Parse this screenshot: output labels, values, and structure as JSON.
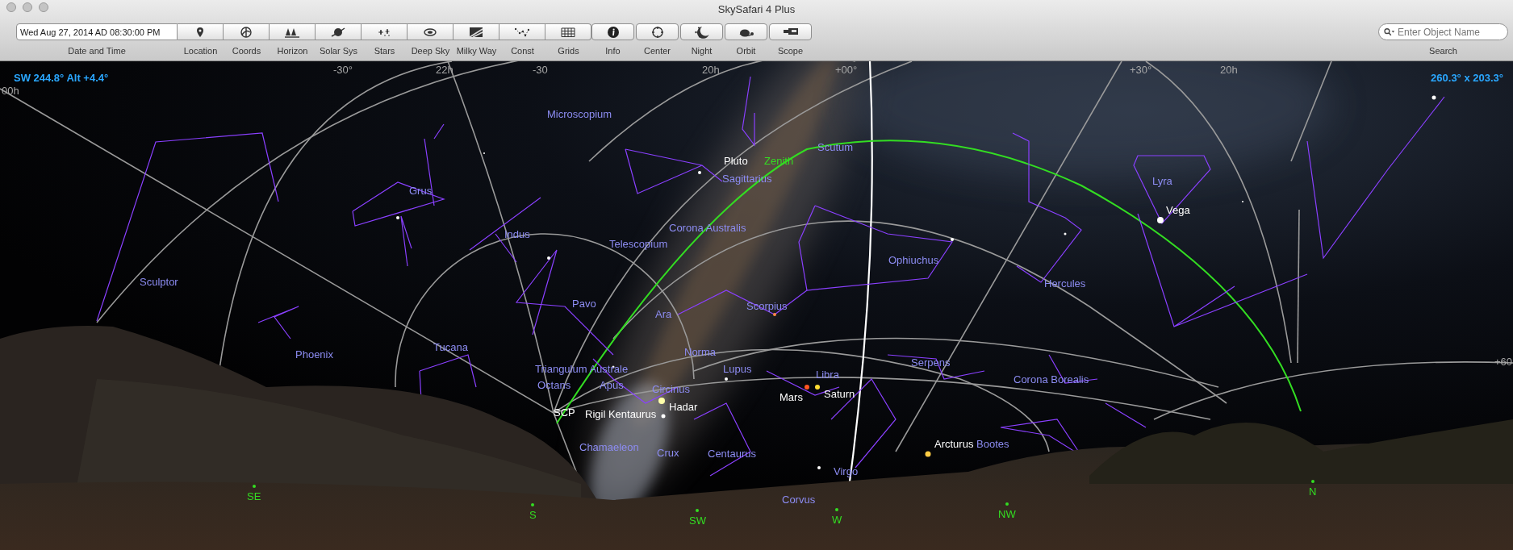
{
  "window": {
    "title": "SkySafari 4 Plus"
  },
  "toolbar": {
    "date_time": {
      "value": "Wed Aug 27, 2014 AD 08:30:00 PM",
      "label": "Date and Time"
    },
    "view_buttons": [
      {
        "label": "Location"
      },
      {
        "label": "Coords"
      },
      {
        "label": "Horizon"
      },
      {
        "label": "Solar Sys"
      },
      {
        "label": "Stars"
      },
      {
        "label": "Deep Sky"
      },
      {
        "label": "Milky Way"
      },
      {
        "label": "Const"
      },
      {
        "label": "Grids"
      }
    ],
    "tool_buttons": [
      {
        "label": "Info"
      },
      {
        "label": "Center"
      },
      {
        "label": "Night"
      },
      {
        "label": "Orbit"
      },
      {
        "label": "Scope"
      }
    ],
    "search": {
      "placeholder": "Enter Object Name",
      "label": "Search"
    }
  },
  "sky_view": {
    "pointing": "SW 244.8° Alt +4.4°",
    "field_of_view": "260.3° x 203.3°",
    "labels": [
      {
        "text": "-30°",
        "kind": "grid"
      },
      {
        "text": "22h",
        "kind": "grid"
      },
      {
        "text": "-30",
        "kind": "grid"
      },
      {
        "text": "20h",
        "kind": "grid"
      },
      {
        "text": "+00°",
        "kind": "grid"
      },
      {
        "text": "+30°",
        "kind": "grid"
      },
      {
        "text": "20h",
        "kind": "grid"
      },
      {
        "text": "00h",
        "kind": "grid"
      },
      {
        "text": "Microscopium",
        "kind": "constellation"
      },
      {
        "text": "Pluto",
        "kind": "object"
      },
      {
        "text": "Zenith",
        "kind": "reference"
      },
      {
        "text": "Scutum",
        "kind": "constellation"
      },
      {
        "text": "Sagittarius",
        "kind": "constellation"
      },
      {
        "text": "Lyra",
        "kind": "constellation"
      },
      {
        "text": "Grus",
        "kind": "constellation"
      },
      {
        "text": "Vega",
        "kind": "object"
      },
      {
        "text": "Corona Australis",
        "kind": "constellation"
      },
      {
        "text": "Indus",
        "kind": "constellation"
      },
      {
        "text": "Telescopium",
        "kind": "constellation"
      },
      {
        "text": "Ophiuchus",
        "kind": "constellation"
      },
      {
        "text": "Sculptor",
        "kind": "constellation"
      },
      {
        "text": "Hercules",
        "kind": "constellation"
      },
      {
        "text": "Pavo",
        "kind": "constellation"
      },
      {
        "text": "Scorpius",
        "kind": "constellation"
      },
      {
        "text": "Ara",
        "kind": "constellation"
      },
      {
        "text": "Phoenix",
        "kind": "constellation"
      },
      {
        "text": "Tucana",
        "kind": "constellation"
      },
      {
        "text": "Norma",
        "kind": "constellation"
      },
      {
        "text": "Serpens",
        "kind": "constellation"
      },
      {
        "text": "+60",
        "kind": "grid"
      },
      {
        "text": "Triangulum Australe",
        "kind": "constellation"
      },
      {
        "text": "Lupus",
        "kind": "constellation"
      },
      {
        "text": "Libra",
        "kind": "constellation"
      },
      {
        "text": "Octans",
        "kind": "constellation"
      },
      {
        "text": "Apus",
        "kind": "constellation"
      },
      {
        "text": "Circinus",
        "kind": "constellation"
      },
      {
        "text": "Corona Borealis",
        "kind": "constellation"
      },
      {
        "text": "Saturn",
        "kind": "object"
      },
      {
        "text": "Mars",
        "kind": "object"
      },
      {
        "text": "Hadar",
        "kind": "object"
      },
      {
        "text": "SCP",
        "kind": "object"
      },
      {
        "text": "Rigil Kentaurus",
        "kind": "object"
      },
      {
        "text": "Chamaeleon",
        "kind": "constellation"
      },
      {
        "text": "Crux",
        "kind": "constellation"
      },
      {
        "text": "Centaurus",
        "kind": "constellation"
      },
      {
        "text": "Arcturus",
        "kind": "object"
      },
      {
        "text": "Bootes",
        "kind": "constellation"
      },
      {
        "text": "Virgo",
        "kind": "constellation"
      },
      {
        "text": "Corvus",
        "kind": "constellation"
      },
      {
        "text": "N",
        "kind": "compass"
      },
      {
        "text": "SE",
        "kind": "compass"
      },
      {
        "text": "NW",
        "kind": "compass"
      },
      {
        "text": "S",
        "kind": "compass"
      },
      {
        "text": "SW",
        "kind": "compass"
      },
      {
        "text": "W",
        "kind": "compass"
      }
    ]
  }
}
